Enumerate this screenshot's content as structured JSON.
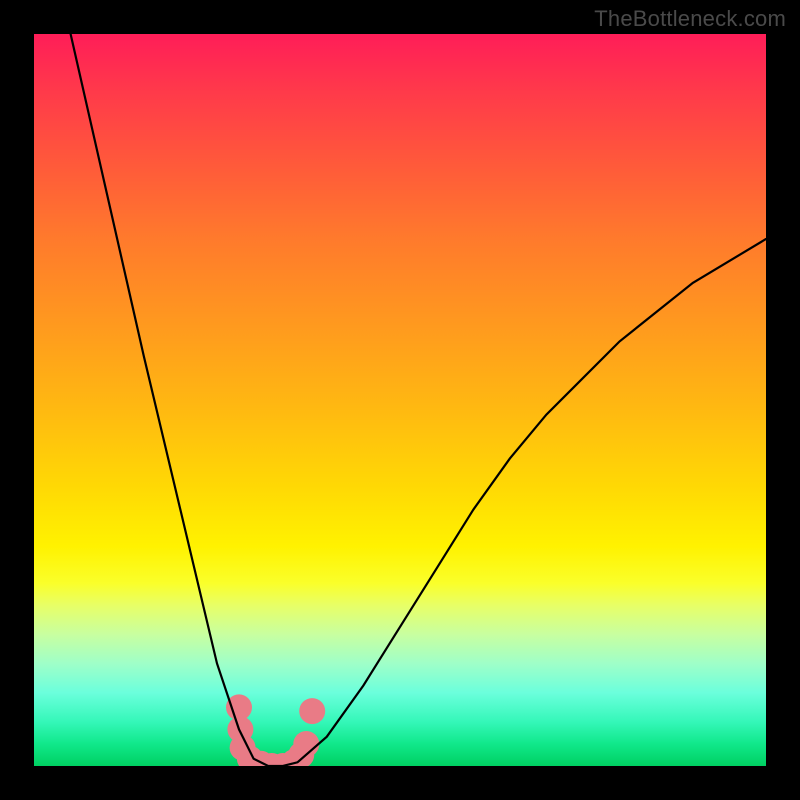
{
  "watermark": "TheBottleneck.com",
  "chart_data": {
    "type": "line",
    "title": "",
    "xlabel": "",
    "ylabel": "",
    "xlim": [
      0,
      100
    ],
    "ylim": [
      0,
      100
    ],
    "grid": false,
    "series": [
      {
        "name": "bottleneck-curve",
        "x": [
          5,
          10,
          15,
          20,
          25,
          28,
          30,
          32,
          34,
          36,
          40,
          45,
          50,
          55,
          60,
          65,
          70,
          80,
          90,
          100
        ],
        "values": [
          100,
          78,
          56,
          35,
          14,
          5,
          1,
          0,
          0,
          0.5,
          4,
          11,
          19,
          27,
          35,
          42,
          48,
          58,
          66,
          72
        ]
      }
    ],
    "markers": {
      "name": "highlight-cluster",
      "shape": "circle",
      "color": "#e97b86",
      "points": [
        {
          "x": 28.0,
          "y": 8.0
        },
        {
          "x": 28.2,
          "y": 5.0
        },
        {
          "x": 28.5,
          "y": 2.5
        },
        {
          "x": 29.5,
          "y": 1.0
        },
        {
          "x": 31.0,
          "y": 0.3
        },
        {
          "x": 32.5,
          "y": 0.0
        },
        {
          "x": 34.0,
          "y": 0.0
        },
        {
          "x": 35.5,
          "y": 0.5
        },
        {
          "x": 36.5,
          "y": 1.5
        },
        {
          "x": 37.2,
          "y": 3.0
        },
        {
          "x": 38.0,
          "y": 7.5
        }
      ]
    },
    "gradient_stops": [
      {
        "pos": 0,
        "color": "#ff1d58"
      },
      {
        "pos": 50,
        "color": "#ffbb10"
      },
      {
        "pos": 70,
        "color": "#fff200"
      },
      {
        "pos": 100,
        "color": "#00d062"
      }
    ]
  }
}
